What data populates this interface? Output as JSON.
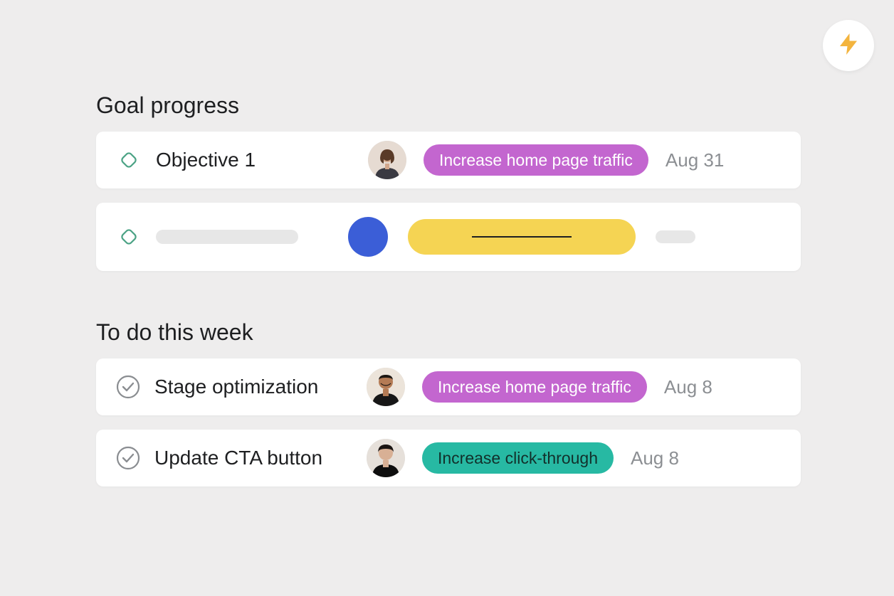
{
  "colors": {
    "tag_purple": "#c366cf",
    "tag_teal": "#27b9a3",
    "placeholder_blue": "#3b5ed7",
    "placeholder_yellow": "#f5d453",
    "lightning": "#f3b43e"
  },
  "lightning_icon": "lightning-icon",
  "goal_section": {
    "title": "Goal progress",
    "items": [
      {
        "icon": "goal-diamond-icon",
        "title": "Objective 1",
        "avatar": "avatar-1",
        "tag": {
          "label": "Increase home page traffic",
          "color": "purple"
        },
        "due": "Aug 31"
      }
    ]
  },
  "todo_section": {
    "title": "To do this week",
    "items": [
      {
        "icon": "check-circle-icon",
        "title": "Stage optimization",
        "avatar": "avatar-2",
        "tag": {
          "label": "Increase home page traffic",
          "color": "purple"
        },
        "due": "Aug 8"
      },
      {
        "icon": "check-circle-icon",
        "title": "Update CTA button",
        "avatar": "avatar-3",
        "tag": {
          "label": "Increase click-through",
          "color": "teal"
        },
        "due": "Aug 8"
      }
    ]
  }
}
